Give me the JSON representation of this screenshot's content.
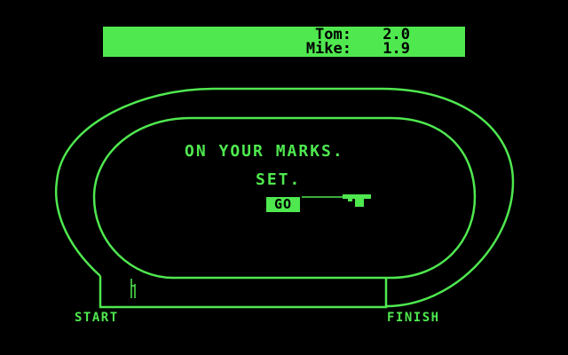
{
  "scoreboard": {
    "rows": [
      {
        "name": "Tom:",
        "value": "2.0"
      },
      {
        "name": "Mike:",
        "value": "1.9"
      }
    ]
  },
  "messages": {
    "on_your_marks": "ON YOUR MARKS.",
    "set": "SET.",
    "go": "GO"
  },
  "track": {
    "start_label": "START",
    "finish_label": "FINISH"
  },
  "colors": {
    "phosphor_green": "#4fe84f",
    "background": "#000000"
  },
  "icons": {
    "starter_pistol": "starter-pistol-icon",
    "runner": "runner-icon"
  }
}
